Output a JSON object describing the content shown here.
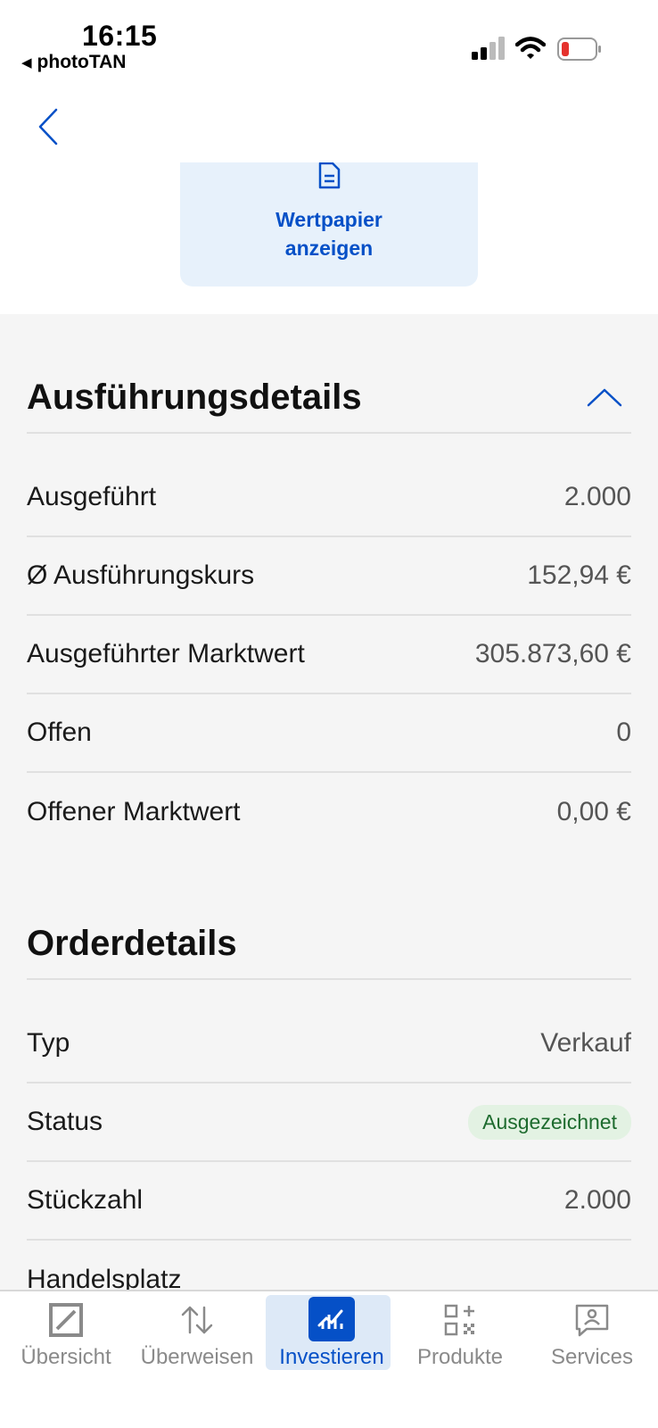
{
  "status_bar": {
    "time": "16:15",
    "back_app": "photoTAN",
    "battery_color": "#e5322d"
  },
  "security_button": {
    "label": "Wertpapier anzeigen",
    "icon": "document-icon"
  },
  "execution": {
    "title": "Ausführungsdetails",
    "rows": [
      {
        "label": "Ausgeführt",
        "value": "2.000"
      },
      {
        "label": "Ø Ausführungskurs",
        "value": "152,94 €"
      },
      {
        "label": "Ausgeführter Marktwert",
        "value": "305.873,60 €"
      },
      {
        "label": "Offen",
        "value": "0"
      },
      {
        "label": "Offener Marktwert",
        "value": "0,00 €"
      }
    ]
  },
  "order": {
    "title": "Orderdetails",
    "rows": [
      {
        "label": "Typ",
        "value": "Verkauf"
      },
      {
        "label": "Status",
        "value": "Ausgezeichnet"
      },
      {
        "label": "Stückzahl",
        "value": "2.000"
      },
      {
        "label": "Handelsplatz",
        "value": ""
      }
    ]
  },
  "tabs": [
    {
      "label": "Übersicht",
      "icon": "deutsche-bank-logo-icon"
    },
    {
      "label": "Überweisen",
      "icon": "transfer-arrows-icon"
    },
    {
      "label": "Investieren",
      "icon": "chart-icon",
      "active": true
    },
    {
      "label": "Produkte",
      "icon": "products-grid-icon"
    },
    {
      "label": "Services",
      "icon": "chat-person-icon"
    }
  ],
  "colors": {
    "accent": "#0550c7",
    "badge_bg": "#e3f2e3",
    "badge_text": "#1d6b2e",
    "content_bg": "#f5f5f5"
  }
}
